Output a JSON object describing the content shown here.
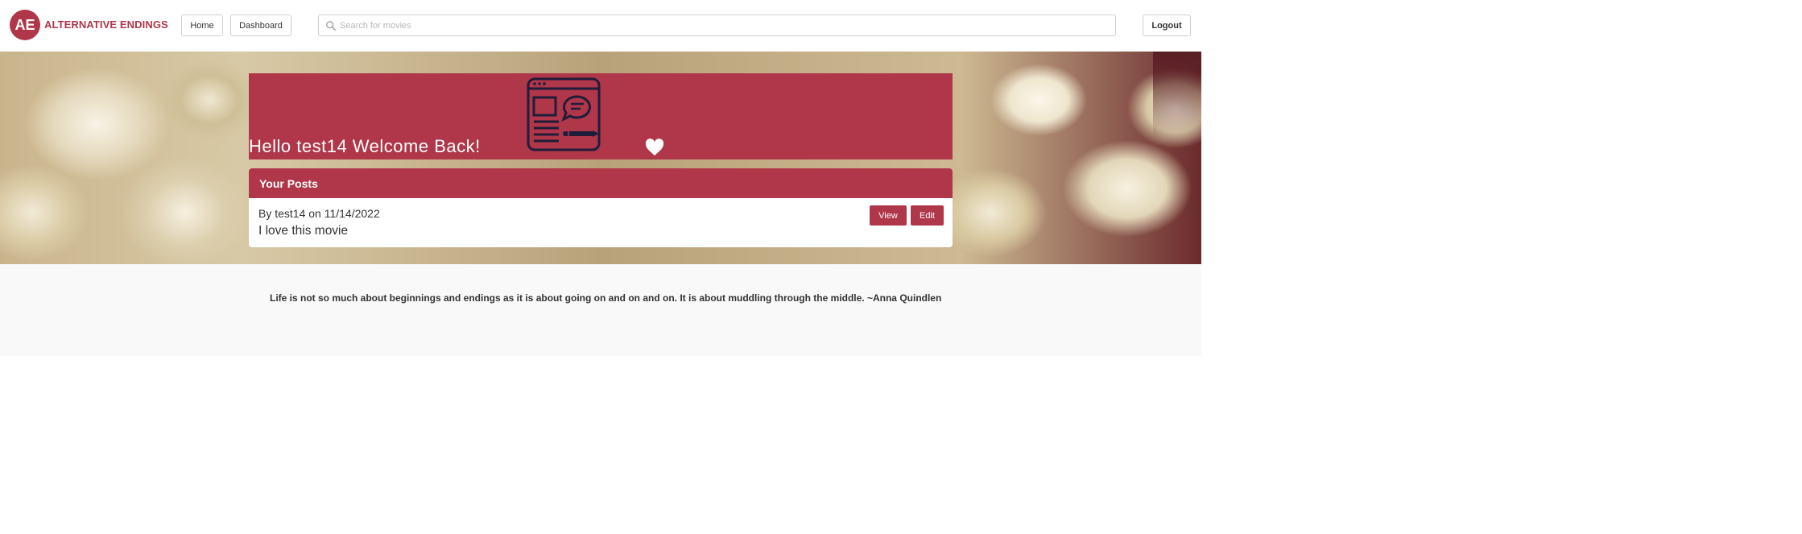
{
  "brand": {
    "initials": "AE",
    "name": "ALTERNATIVE ENDINGS",
    "color": "#b0364a"
  },
  "nav": {
    "home_label": "Home",
    "dashboard_label": "Dashboard",
    "logout_label": "Logout"
  },
  "search": {
    "placeholder": "Search for movies",
    "value": "",
    "icon": "search-icon"
  },
  "hero": {
    "greeting": "Hello test14 Welcome Back!",
    "banner_icon": "web-page-chat-icon",
    "heart_icon": "heart-icon"
  },
  "posts": {
    "header": "Your Posts",
    "items": [
      {
        "meta": "By test14 on 11/14/2022",
        "body": "I love this movie",
        "view_label": "View",
        "edit_label": "Edit"
      }
    ]
  },
  "quote": "Life is not so much about beginnings and endings as it is about going on and on and on. It is about muddling through the middle. ~Anna Quindlen"
}
